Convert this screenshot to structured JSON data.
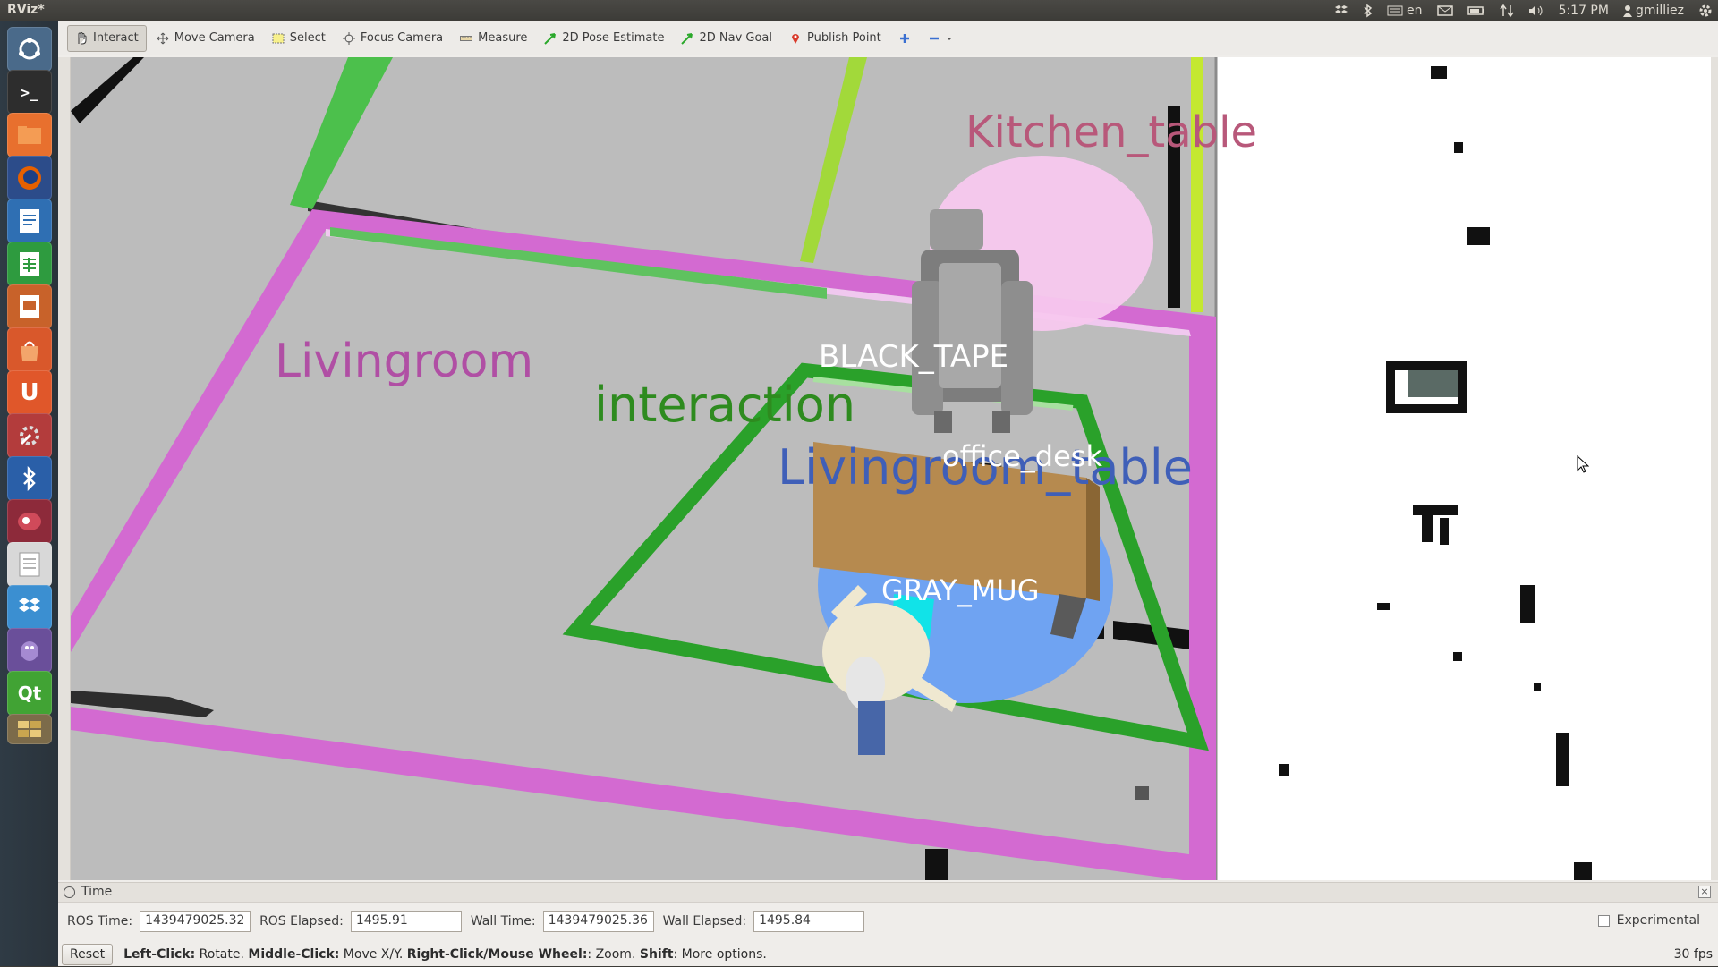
{
  "window": {
    "title": "RViz*"
  },
  "tray": {
    "language": "en",
    "time": "5:17 PM",
    "user": "gmilliez"
  },
  "launcher": {
    "items": [
      "ubuntu-dash-icon",
      "terminal-icon",
      "files-icon",
      "firefox-icon",
      "writer-icon",
      "calc-icon",
      "impress-icon",
      "software-center-icon",
      "ubuntu-one-icon",
      "system-settings-icon",
      "bluetooth-icon",
      "rviz-icon",
      "text-editor-icon",
      "dropbox-icon",
      "pidgin-icon",
      "qt-creator-icon",
      "workspaces-icon"
    ]
  },
  "toolbar": {
    "tools": [
      {
        "id": "interact",
        "label": "Interact",
        "active": true
      },
      {
        "id": "move-camera",
        "label": "Move Camera"
      },
      {
        "id": "select",
        "label": "Select"
      },
      {
        "id": "focus-camera",
        "label": "Focus Camera"
      },
      {
        "id": "measure",
        "label": "Measure"
      },
      {
        "id": "2d-pose-estimate",
        "label": "2D Pose Estimate"
      },
      {
        "id": "2d-nav-goal",
        "label": "2D Nav Goal"
      },
      {
        "id": "publish-point",
        "label": "Publish Point"
      }
    ]
  },
  "scene": {
    "labels": {
      "kitchen_table": "Kitchen_table",
      "livingroom": "Livingroom",
      "interaction": "interaction",
      "black_tape": "BLACK_TAPE",
      "office_desk": "office_desk",
      "livingroom_table": "Livingroom_table",
      "gray_mug": "GRAY_MUG"
    },
    "colors": {
      "zone_magenta": "#d36ad1",
      "zone_green": "#2aa12a",
      "kitchen_label": "#b8587a",
      "livingroom_label": "#b04fa4",
      "interaction_label": "#2e8b1f",
      "livingroom_table_label": "#3f5fb8",
      "floor": "#bcbcbc"
    }
  },
  "time_panel": {
    "title": "Time",
    "ros_time_label": "ROS Time:",
    "ros_time": "1439479025.32",
    "ros_elapsed_label": "ROS Elapsed:",
    "ros_elapsed": "1495.91",
    "wall_time_label": "Wall Time:",
    "wall_time": "1439479025.36",
    "wall_elapsed_label": "Wall Elapsed:",
    "wall_elapsed": "1495.84",
    "experimental_label": "Experimental"
  },
  "status": {
    "reset_label": "Reset",
    "hint": [
      {
        "b": "Left-Click:",
        "t": " Rotate. "
      },
      {
        "b": "Middle-Click:",
        "t": " Move X/Y. "
      },
      {
        "b": "Right-Click/Mouse Wheel:",
        "t": ": Zoom. "
      },
      {
        "b": "Shift",
        "t": ": More options."
      }
    ],
    "fps": "30 fps"
  }
}
